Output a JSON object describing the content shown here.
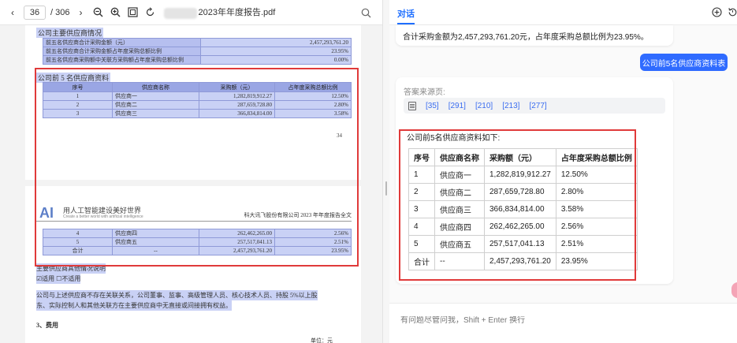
{
  "pdf": {
    "toolbar": {
      "prev_icon": "chevron-left-icon",
      "page_current": "36",
      "page_total": "/ 306",
      "next_icon": "chevron-right-icon",
      "file_name": "2023年年度报告.pdf"
    },
    "page1": {
      "section_top": "公司主要供应商情况",
      "summary_rows": [
        {
          "label": "前五名供应商合计采购金额（元）",
          "value": "2,457,293,761.20"
        },
        {
          "label": "前五名供应商合计采购金额占年度采购总额比例",
          "value": "23.95%"
        },
        {
          "label": "前五名供应商采购额中关联方采购额占年度采购总额比例",
          "value": "0.00%"
        }
      ],
      "section_top5": "公司前 5 名供应商资料",
      "headers": [
        "序号",
        "供应商名称",
        "采购额（元）",
        "占年度采购总额比例"
      ],
      "rows": [
        [
          "1",
          "供应商一",
          "1,282,819,912.27",
          "12.50%"
        ],
        [
          "2",
          "供应商二",
          "287,659,728.80",
          "2.80%"
        ],
        [
          "3",
          "供应商三",
          "366,834,814.00",
          "3.58%"
        ]
      ],
      "page_number": "34"
    },
    "page2": {
      "logo": "AI",
      "logo_text": "用人工智能建设美好世界",
      "logo_sub": "Create a better world with artificial intelligence",
      "header_right": "科大讯飞股份有限公司 2023 年年度报告全文",
      "rows": [
        [
          "4",
          "供应商四",
          "262,462,265.00",
          "2.56%"
        ],
        [
          "5",
          "供应商五",
          "257,517,041.13",
          "2.51%"
        ],
        [
          "合计",
          "--",
          "2,457,293,761.20",
          "23.95%"
        ]
      ],
      "para1": "主要供应商其他情况说明",
      "para2": "☑适用 ☐不适用",
      "para3": "公司与上述供应商不存在关联关系，公司董事、监事、高级管理人员、核心技术人员、持股 5%以上股",
      "para4": "东、实际控制人和其他关联方在主要供应商中无直接或间接拥有权益。",
      "para5": "3、费用",
      "para6": "单位：元"
    }
  },
  "chat": {
    "tab_label": "对话",
    "top_answer_text": "合计采购金额为2,457,293,761.20元，占年度采购总额比例为23.95%。",
    "user_message": "公司前5名供应商资料表",
    "source_label": "答案来源页:",
    "source_links": [
      "[35]",
      "[291]",
      "[210]",
      "[213]",
      "[277]"
    ],
    "answer_title": "公司前5名供应商资料如下:",
    "table_headers": [
      "序号",
      "供应商名称",
      "采购额（元）",
      "占年度采购总额比例"
    ],
    "table_rows": [
      [
        "1",
        "供应商一",
        "1,282,819,912.27",
        "12.50%"
      ],
      [
        "2",
        "供应商二",
        "287,659,728.80",
        "2.80%"
      ],
      [
        "3",
        "供应商三",
        "366,834,814.00",
        "3.58%"
      ],
      [
        "4",
        "供应商四",
        "262,462,265.00",
        "2.56%"
      ],
      [
        "5",
        "供应商五",
        "257,517,041.13",
        "2.51%"
      ],
      [
        "合计",
        "--",
        "2,457,293,761.20",
        "23.95%"
      ]
    ],
    "input_placeholder": "有问题尽管问我，Shift + Enter 换行"
  },
  "colors": {
    "accent": "#1f6fff",
    "highlight": "#c9d1f5",
    "annotation_red": "#e03a3a"
  }
}
